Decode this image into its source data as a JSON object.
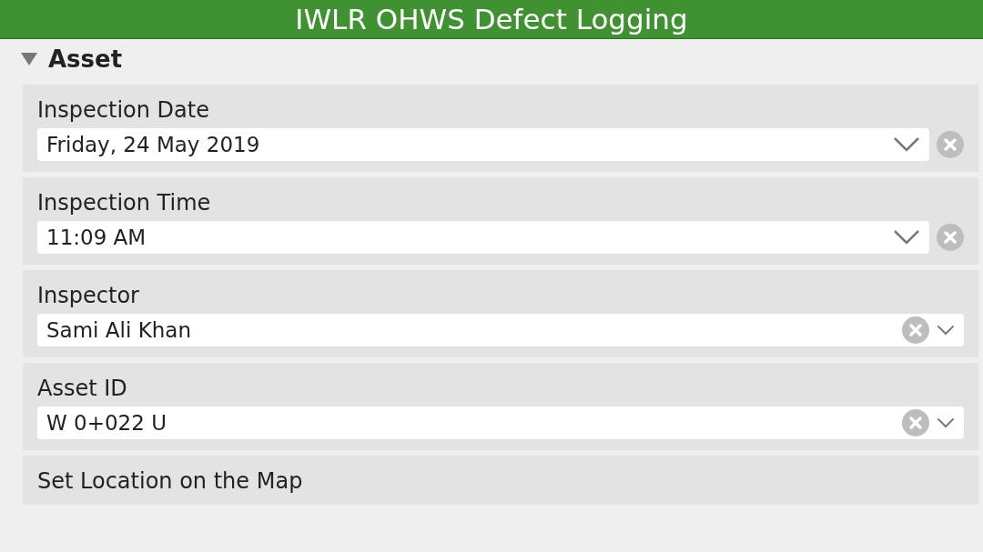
{
  "title": "IWLR OHWS Defect Logging",
  "section": {
    "label": "Asset",
    "expanded": true
  },
  "fields": [
    {
      "label": "Inspection Date",
      "value": "Friday, 24 May 2019",
      "kind": "picker"
    },
    {
      "label": "Inspection Time",
      "value": "11:09 AM",
      "kind": "picker"
    },
    {
      "label": "Inspector",
      "value": "Sami Ali Khan",
      "kind": "select"
    },
    {
      "label": "Asset ID",
      "value": "W 0+022 U",
      "kind": "select"
    },
    {
      "label": "Set Location on the Map",
      "kind": "location"
    }
  ]
}
